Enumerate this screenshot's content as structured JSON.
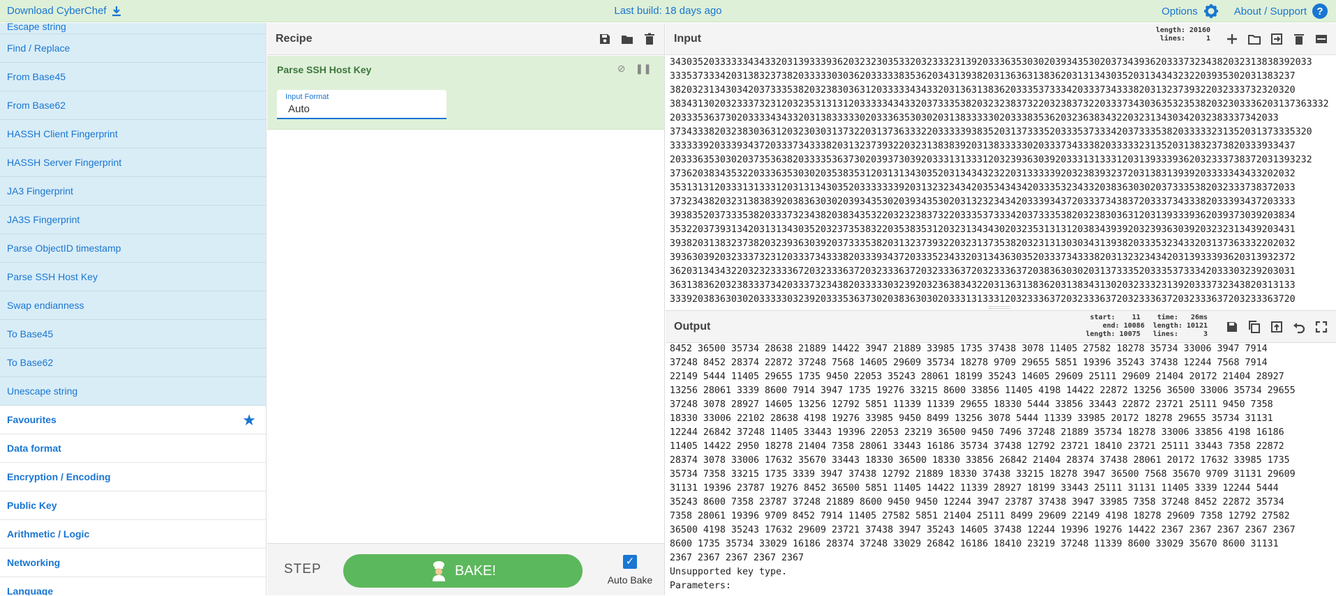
{
  "banner": {
    "download_label": "Download CyberChef",
    "build": "Last build: 18 days ago",
    "options_label": "Options",
    "about_label": "About / Support"
  },
  "operations": {
    "partial_item": "Escape string",
    "items": [
      "Find / Replace",
      "From Base45",
      "From Base62",
      "HASSH Client Fingerprint",
      "HASSH Server Fingerprint",
      "JA3 Fingerprint",
      "JA3S Fingerprint",
      "Parse ObjectID timestamp",
      "Parse SSH Host Key",
      "Swap endianness",
      "To Base45",
      "To Base62",
      "Unescape string"
    ],
    "categories": [
      "Favourites",
      "Data format",
      "Encryption / Encoding",
      "Public Key",
      "Arithmetic / Logic",
      "Networking",
      "Language"
    ]
  },
  "recipe": {
    "title": "Recipe",
    "operation_name": "Parse SSH Host Key",
    "input_format_label": "Input Format",
    "input_format_value": "Auto",
    "step_label": "STEP",
    "bake_label": "BAKE!",
    "auto_bake_label": "Auto Bake",
    "auto_bake_checked": true
  },
  "input": {
    "title": "Input",
    "stats": "length: 20160\n lines:     1",
    "lines": [
      "3430352033333343433203139333936203232303533203233323139203336353030203934353020373439362033373234382032313838392033",
      "3335373334203138323738203333303036203333383536203431393820313636313836203131343035203134343232203935302031383237",
      "3820323134303420373335382032383036312033333434332031363138362033353733342033373433382031323739322032333732320320",
      "3834313020323337323120323531313120333334343320373335382032323837322032383732203337343036353235382032303336203137363332",
      "2033353637302033334343320313833333020333635303020313833333020333835362032363834322032313430342032383337342033",
      "3734333820323830363120323030313732203137363332203333393835203137333520333537333420373335382033333231352031373335320",
      "3333339203339343720333734333820313237393220323138383920313833333020333734333820333332313520313832373820333933437",
      "2033363530302037353638203333536373020393730392033313133312032393630392033313133312031393339362032333738372031393232",
      "3736203834353220333635303020353835312031313430352031343432322031333339203238393237203138313939203333343433202032",
      "3531313120333131333120313134303520333333392031323234342035343434203335323433203836303020373335382032333738372033",
      "3732343820323138383920383630302039343530203934353020313232343420333934372033373438372033373433382033393437203333",
      "3938352037333538203337323438203834353220323238373220333537333420373335382032383036312031393339362039373039203834",
      "3532203739313420313134303520323735383220353835312032313434302032353131312038343939203239363039203232313439203431",
      "3938203138323738203239363039203733353820313237393220323137353820323131303034313938203335323433203137363332202032",
      "3936303920323337323120333734333820333934372033352343320313436303520333734333820313232343420313933393620313932372",
      "3620313434322032323333672032333637203233363720323336372032333637203836303020313733352033353733342033303239203031",
      "3631383620323833373420333732343820333330323920323638343220313631383620313834313020323332313920333732343820313133",
      "3339203836303020333330323920333536373020383630302033313133312032333637203233363720323336372032333637203233363720"
    ]
  },
  "output": {
    "title": "Output",
    "stats": "start:    11    time:   26ms\n  end: 10086  length: 10121\nlength: 10075   lines:      3",
    "lines": [
      "8452 36500 35734 28638 21889 14422 3947 21889 33985 1735 37438 3078 11405 27582 18278 35734 33006 3947 7914",
      "37248 8452 28374 22872 37248 7568 14605 29609 35734 18278 9709 29655 5851 19396 35243 37438 12244 7568 7914",
      "22149 5444 11405 29655 1735 9450 22053 35243 28061 18199 35243 14605 29609 25111 29609 21404 20172 21404 28927",
      "13256 28061 3339 8600 7914 3947 1735 19276 33215 8600 33856 11405 4198 14422 22872 13256 36500 33006 35734 29655",
      "37248 3078 28927 14605 13256 12792 5851 11339 11339 29655 18330 5444 33856 33443 22872 23721 25111 9450 7358",
      "18330 33006 22102 28638 4198 19276 33985 9450 8499 13256 3078 5444 11339 33985 20172 18278 29655 35734 31131",
      "12244 26842 37248 11405 33443 19396 22053 23219 36500 9450 7496 37248 21889 35734 18278 33006 33856 4198 16186",
      "11405 14422 2950 18278 21404 7358 28061 33443 16186 35734 37438 12792 23721 18410 23721 25111 33443 7358 22872",
      "28374 3078 33006 17632 35670 33443 18330 36500 18330 33856 26842 21404 28374 37438 28061 20172 17632 33985 1735",
      "35734 7358 33215 1735 3339 3947 37438 12792 21889 18330 37438 33215 18278 3947 36500 7568 35670 9709 31131 29609",
      "31131 19396 23787 19276 8452 36500 5851 11405 14422 11339 28927 18199 33443 25111 31131 11405 3339 12244 5444",
      "35243 8600 7358 23787 37248 21889 8600 9450 9450 12244 3947 23787 37438 3947 33985 7358 37248 8452 22872 35734",
      "7358 28061 19396 9709 8452 7914 11405 27582 5851 21404 25111 8499 29609 22149 4198 18278 29609 7358 12792 27582",
      "36500 4198 35243 17632 29609 23721 37438 3947 35243 14605 37438 12244 19396 19276 14422 2367 2367 2367 2367 2367",
      "8600 1735 35734 33029 16186 28374 37248 33029 26842 16186 18410 23219 37248 11339 8600 33029 35670 8600 31131",
      "2367 2367 2367 2367 2367",
      "Unsupported key type.",
      "Parameters:"
    ]
  }
}
